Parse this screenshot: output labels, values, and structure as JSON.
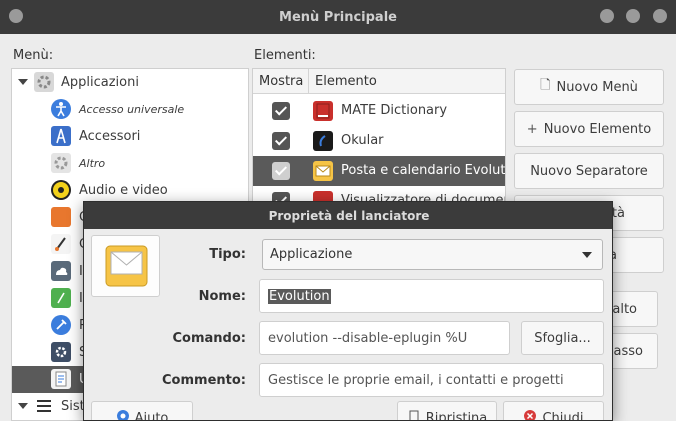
{
  "window": {
    "title": "Menù Principale"
  },
  "menus": {
    "label": "Menù:",
    "items": [
      {
        "label": "Applicazioni",
        "icon": "gear-icon",
        "italic": false
      },
      {
        "label": "Accesso universale",
        "icon": "accessibility-icon",
        "italic": true
      },
      {
        "label": "Accessori",
        "icon": "accessories-icon",
        "italic": false
      },
      {
        "label": "Altro",
        "icon": "gear-icon",
        "italic": true
      },
      {
        "label": "Audio e video",
        "icon": "audio-video-icon",
        "italic": false
      },
      {
        "label": "G",
        "icon": "games-icon",
        "italic": false
      },
      {
        "label": "G",
        "icon": "graphics-icon",
        "italic": false
      },
      {
        "label": "I",
        "icon": "internet-icon",
        "italic": false
      },
      {
        "label": "I",
        "icon": "office-icon",
        "italic": false
      },
      {
        "label": "P",
        "icon": "programming-icon",
        "italic": false
      },
      {
        "label": "S",
        "icon": "settings-icon",
        "italic": false
      },
      {
        "label": "U",
        "icon": "office-doc-icon",
        "italic": false
      },
      {
        "label": "Sist",
        "icon": "system-icon",
        "italic": false
      }
    ]
  },
  "elements": {
    "label": "Elementi:",
    "col_show": "Mostra",
    "col_item": "Elemento",
    "rows": [
      {
        "label": "MATE Dictionary",
        "icon": "dictionary-icon"
      },
      {
        "label": "Okular",
        "icon": "okular-icon"
      },
      {
        "label": "Posta e calendario Evolution",
        "icon": "mail-icon"
      },
      {
        "label": "Visualizzatore di documenti",
        "icon": "document-viewer-icon"
      }
    ]
  },
  "actions": {
    "new_menu": "Nuovo Menù",
    "new_item": "Nuovo Elemento",
    "new_separator": "Nuovo Separatore",
    "properties_partial": "età",
    "delete_partial": "a",
    "move_up_partial": "alto",
    "move_down_partial": "basso"
  },
  "dialog": {
    "title": "Proprietà del lanciatore",
    "type_label": "Tipo:",
    "type_value": "Applicazione",
    "name_label": "Nome:",
    "name_value": "Evolution",
    "command_label": "Comando:",
    "command_value": "evolution --disable-eplugin %U",
    "browse_label": "Sfoglia...",
    "comment_label": "Commento:",
    "comment_value": "Gestisce le proprie email, i contatti e progetti",
    "help_label": "Aiuto",
    "revert_label": "Ripristina",
    "close_label": "Chiudi"
  },
  "colors": {
    "titlebar": "#3b3b3b",
    "selection": "#5a5a5a",
    "close_red": "#d73a3a"
  }
}
